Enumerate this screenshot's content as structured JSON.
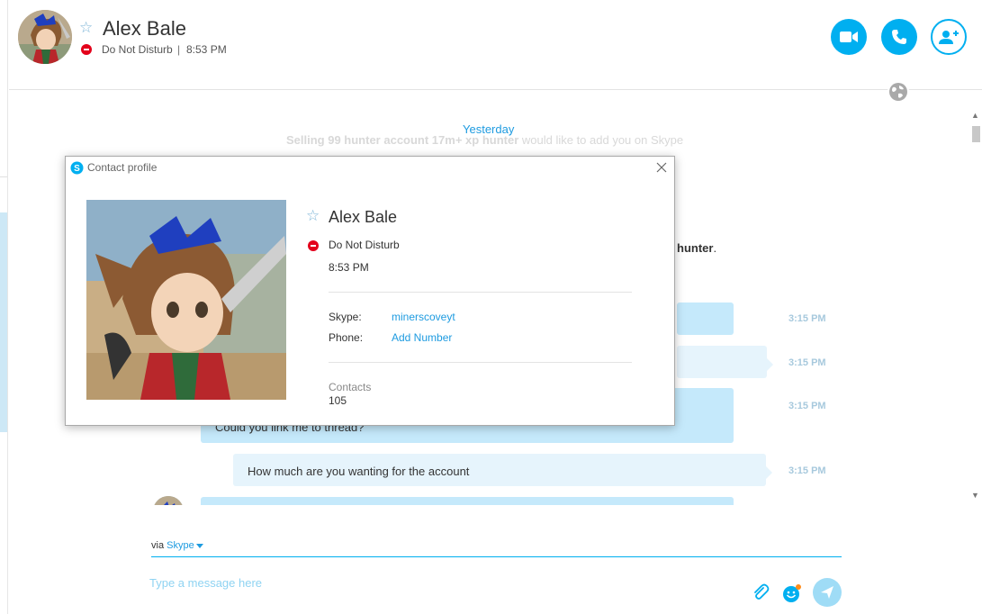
{
  "header": {
    "name": "Alex Bale",
    "status": "Do Not Disturb",
    "separator": "|",
    "time": "8:53 PM"
  },
  "chat": {
    "date_separator": "Yesterday",
    "system_message": {
      "bold_part": "Selling 99 hunter account 17m+ xp hunter",
      "rest": " would like to add you on Skype"
    },
    "partial_message": {
      "bold": "hunter",
      "tail": "."
    },
    "messages": [
      {
        "text": "",
        "time": "3:15 PM"
      },
      {
        "text": "",
        "time": "3:15 PM"
      },
      {
        "text": "Could you link me to thread?",
        "time": "3:15 PM"
      },
      {
        "text": "How much are you wanting for the account",
        "time": "3:15 PM"
      }
    ]
  },
  "compose": {
    "via_label": "via",
    "via_service": "Skype",
    "placeholder": "Type a message here"
  },
  "profile_dialog": {
    "title": "Contact profile",
    "name": "Alex Bale",
    "status": "Do Not Disturb",
    "time": "8:53 PM",
    "skype_label": "Skype:",
    "skype_value": "minerscoveyt",
    "phone_label": "Phone:",
    "phone_value": "Add Number",
    "contacts_label": "Contacts",
    "contacts_value": "105"
  },
  "colors": {
    "accent": "#00aff0",
    "link": "#1e9be0",
    "dnd": "#e3001b",
    "bubble": "#c5e9fb",
    "bubble_light": "#e6f4fc"
  },
  "icons": [
    "star-icon",
    "dnd-status-icon",
    "video-call-icon",
    "audio-call-icon",
    "add-contact-icon",
    "globe-icon",
    "skype-logo-icon",
    "close-icon",
    "attach-icon",
    "emoji-icon",
    "send-icon"
  ]
}
